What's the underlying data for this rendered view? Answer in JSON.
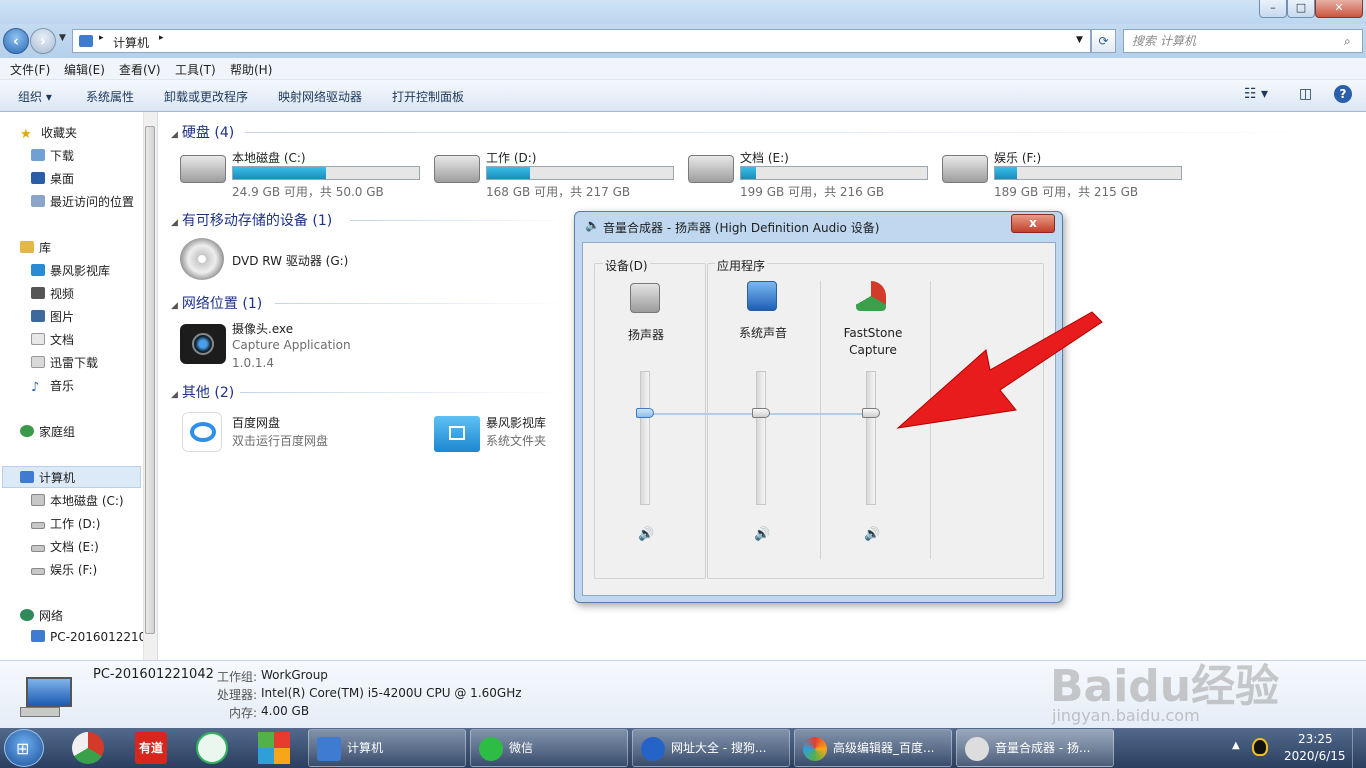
{
  "address": {
    "root": "计算机",
    "search_placeholder": "搜索 计算机"
  },
  "menubar": [
    "文件(F)",
    "编辑(E)",
    "查看(V)",
    "工具(T)",
    "帮助(H)"
  ],
  "commandbar": [
    "组织 ▾",
    "系统属性",
    "卸载或更改程序",
    "映射网络驱动器",
    "打开控制面板"
  ],
  "nav": {
    "favorites": {
      "label": "收藏夹",
      "items": [
        "下载",
        "桌面",
        "最近访问的位置"
      ]
    },
    "libraries": {
      "label": "库",
      "items": [
        "暴风影视库",
        "视频",
        "图片",
        "文档",
        "迅雷下载",
        "音乐"
      ]
    },
    "homegroup": "家庭组",
    "computer": {
      "label": "计算机",
      "items": [
        "本地磁盘 (C:)",
        "工作 (D:)",
        "文档 (E:)",
        "娱乐 (F:)"
      ]
    },
    "network": {
      "label": "网络",
      "items": [
        "PC-2016012210"
      ]
    }
  },
  "groups": {
    "hdd": "硬盘 (4)",
    "removable": "有可移动存储的设备 (1)",
    "network": "网络位置 (1)",
    "other": "其他 (2)"
  },
  "drives": [
    {
      "name": "本地磁盘 (C:)",
      "free": "24.9 GB 可用，共 50.0 GB",
      "used_fraction": 0.5
    },
    {
      "name": "工作 (D:)",
      "free": "168 GB 可用，共 217 GB",
      "used_fraction": 0.23
    },
    {
      "name": "文档 (E:)",
      "free": "199 GB 可用，共 216 GB",
      "used_fraction": 0.08
    },
    {
      "name": "娱乐 (F:)",
      "free": "189 GB 可用，共 215 GB",
      "used_fraction": 0.12
    }
  ],
  "dvd": {
    "name": "DVD RW 驱动器 (G:)"
  },
  "network_item": {
    "name": "摄像头.exe",
    "sub1": "Capture Application",
    "sub2": "1.0.1.4"
  },
  "other_items": [
    {
      "name": "百度网盘",
      "sub": "双击运行百度网盘"
    },
    {
      "name": "暴风影视库",
      "sub": "系统文件夹"
    }
  ],
  "details": {
    "pc_name": "PC-201601221042",
    "workgroup_label": "工作组:",
    "workgroup": "WorkGroup",
    "cpu_label": "处理器:",
    "cpu": "Intel(R) Core(TM) i5-4200U CPU @ 1.60GHz",
    "mem_label": "内存:",
    "mem": "4.00 GB"
  },
  "mixer": {
    "title": "音量合成器 - 扬声器 (High Definition Audio 设备)",
    "close": "x",
    "device_label": "设备(D)",
    "apps_label": "应用程序",
    "channels": [
      {
        "name": "扬声器",
        "level": 0.7
      },
      {
        "name": "系统声音",
        "level": 0.7
      },
      {
        "name": "FastStone",
        "name2": "Capture",
        "level": 0.7
      }
    ]
  },
  "taskbar": {
    "buttons": [
      "计算机",
      "微信",
      "网址大全 - 搜狗...",
      "高级编辑器_百度...",
      "音量合成器 - 扬..."
    ],
    "pinned_youdao": "有道",
    "time": "23:25",
    "date": "2020/6/15"
  },
  "watermark": {
    "brand": "Baidu经验",
    "url": "jingyan.baidu.com"
  },
  "colors": {
    "accent": "#1e3287",
    "bar_fill": "#26a6d1",
    "arrow": "#e81c1c"
  }
}
